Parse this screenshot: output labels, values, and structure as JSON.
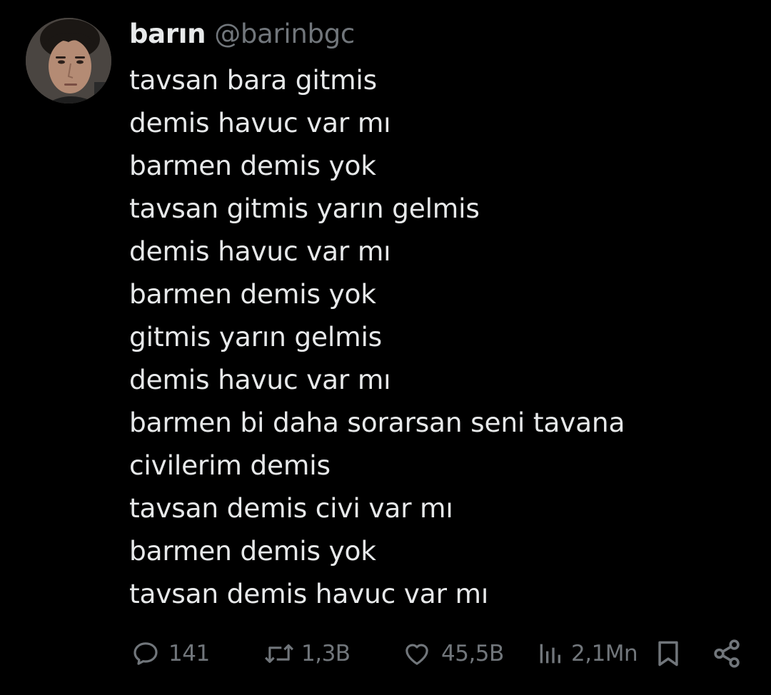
{
  "author": {
    "display_name": "barın",
    "handle": "@barinbgc"
  },
  "tweet": {
    "lines": [
      "tavsan bara gitmis",
      "demis havuc var mı",
      "barmen demis yok",
      "tavsan gitmis yarın gelmis",
      "demis havuc var mı",
      "barmen demis yok",
      "gitmis yarın gelmis",
      "demis havuc var mı",
      "barmen bi daha sorarsan seni tavana",
      "civilerim demis",
      "tavsan demis civi var mı",
      "barmen demis yok",
      "tavsan demis havuc var mı"
    ]
  },
  "actions": {
    "replies": "141",
    "reposts": "1,3B",
    "likes": "45,5B",
    "views": "2,1Mn"
  },
  "icons": {
    "reply": "reply-icon",
    "repost": "repost-icon",
    "like": "heart-icon",
    "views": "views-icon",
    "bookmark": "bookmark-icon",
    "share": "share-icon"
  },
  "colors": {
    "background": "#000000",
    "text": "#e7e9ea",
    "secondary": "#71767b"
  }
}
